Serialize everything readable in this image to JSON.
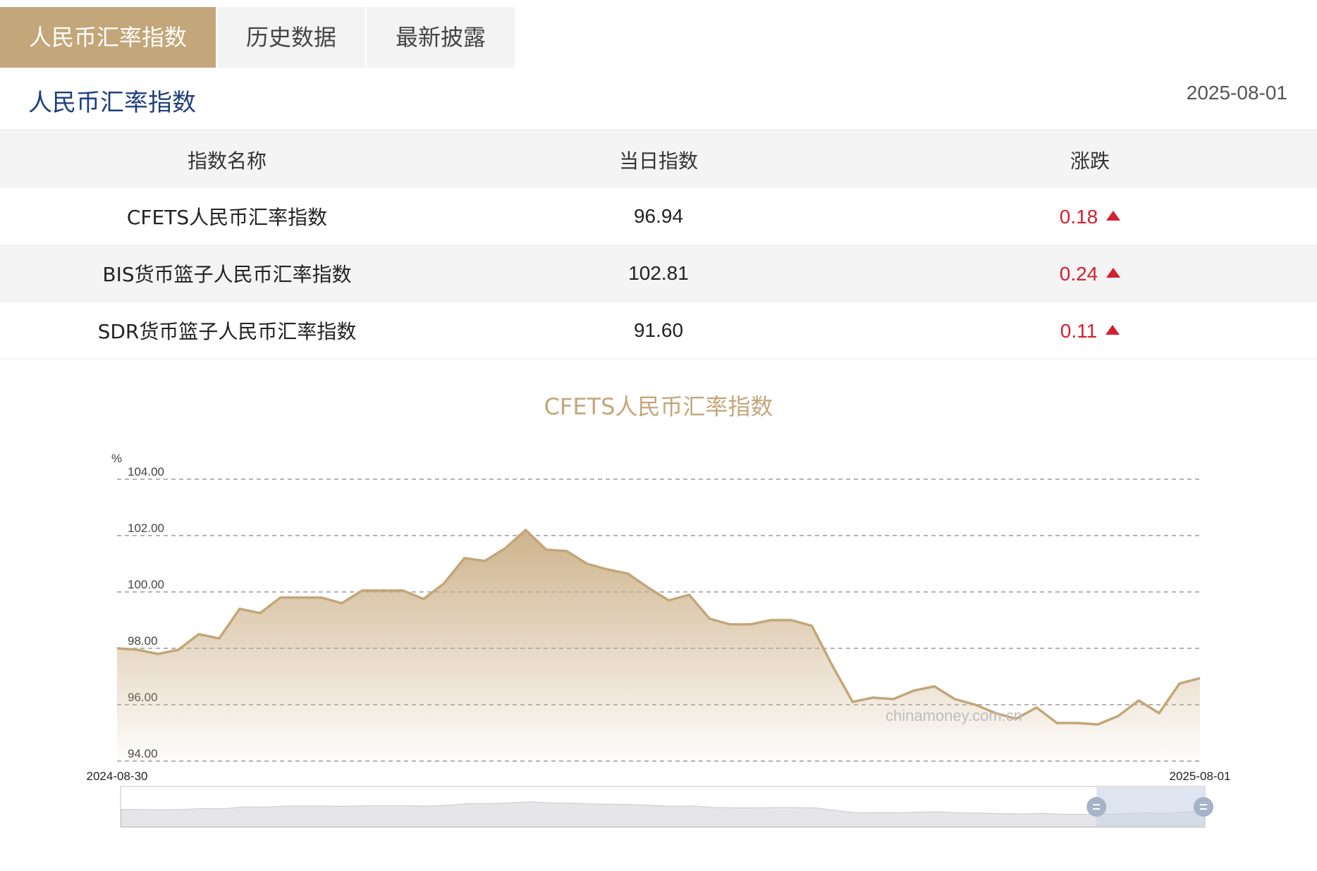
{
  "tabs": [
    "人民币汇率指数",
    "历史数据",
    "最新披露"
  ],
  "section": {
    "title": "人民币汇率指数",
    "date": "2025-08-01"
  },
  "table": {
    "headers": [
      "指数名称",
      "当日指数",
      "涨跌"
    ],
    "rows": [
      {
        "name": "CFETS人民币汇率指数",
        "value": "96.94",
        "change": "0.18",
        "direction": "up"
      },
      {
        "name": "BIS货币篮子人民币汇率指数",
        "value": "102.81",
        "change": "0.24",
        "direction": "up"
      },
      {
        "name": "SDR货币篮子人民币汇率指数",
        "value": "91.60",
        "change": "0.11",
        "direction": "up"
      }
    ]
  },
  "colors": {
    "accent": "#c3a679",
    "up": "#d3202f",
    "title_blue": "#1d3f7f"
  },
  "chart_data": {
    "type": "area",
    "title": "CFETS人民币汇率指数",
    "ylabel": "%",
    "ylim": [
      94,
      104
    ],
    "y_ticks": [
      "104.00",
      "102.00",
      "100.00",
      "98.00",
      "96.00",
      "94.00"
    ],
    "x_start_label": "2024-08-30",
    "x_end_label": "2025-08-01",
    "grid": true,
    "watermark": "chinamoney.com.cn",
    "series": [
      {
        "values": [
          98.0,
          97.95,
          97.8,
          97.95,
          98.5,
          98.35,
          99.4,
          99.25,
          99.8,
          99.8,
          99.8,
          99.6,
          100.05,
          100.05,
          100.05,
          99.75,
          100.3,
          101.2,
          101.1,
          101.55,
          102.2,
          101.5,
          101.45,
          101.0,
          100.8,
          100.65,
          100.15,
          99.7,
          99.9,
          99.05,
          98.85,
          98.85,
          99.0,
          99.0,
          98.8,
          97.4,
          96.1,
          96.25,
          96.2,
          96.5,
          96.65,
          96.2,
          96.0,
          95.7,
          95.5,
          95.9,
          95.35,
          95.35,
          95.3,
          95.6,
          96.15,
          95.7,
          96.75,
          96.94
        ]
      }
    ],
    "slider_range": [
      0.9,
      1.0
    ]
  }
}
